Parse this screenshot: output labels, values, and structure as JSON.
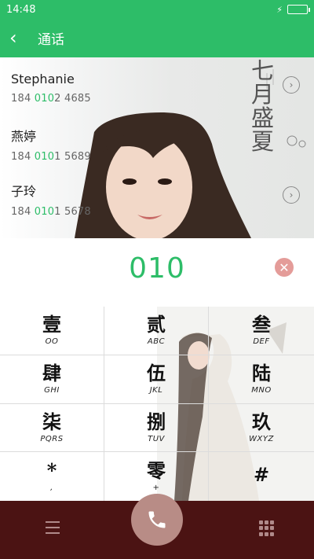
{
  "status": {
    "time": "14:48"
  },
  "header": {
    "title": "通话"
  },
  "results": {
    "art_text": "七月盛夏",
    "contacts": [
      {
        "name": "Stephanie",
        "num_prefix": "184 ",
        "num_match": "010",
        "num_suffix": "2 4685"
      },
      {
        "name": "燕婷",
        "num_prefix": "184 ",
        "num_match": "010",
        "num_suffix": "1 5689"
      },
      {
        "name": "子玲",
        "num_prefix": "184 ",
        "num_match": "010",
        "num_suffix": "1 5678"
      }
    ]
  },
  "dialer": {
    "digits": "010"
  },
  "keypad": {
    "keys": [
      {
        "glyph": "壹",
        "sub": "OO"
      },
      {
        "glyph": "贰",
        "sub": "ABC"
      },
      {
        "glyph": "叁",
        "sub": "DEF"
      },
      {
        "glyph": "肆",
        "sub": "GHI"
      },
      {
        "glyph": "伍",
        "sub": "JKL"
      },
      {
        "glyph": "陆",
        "sub": "MNO"
      },
      {
        "glyph": "柒",
        "sub": "PQRS"
      },
      {
        "glyph": "捌",
        "sub": "TUV"
      },
      {
        "glyph": "玖",
        "sub": "WXYZ"
      },
      {
        "glyph": "*",
        "sub": ","
      },
      {
        "glyph": "零",
        "sub": "+"
      },
      {
        "glyph": "#",
        "sub": ""
      }
    ]
  },
  "colors": {
    "accent": "#2dbd68",
    "bottom_bar": "#4b1313",
    "call_button": "#b88c86",
    "clear_button": "#e49c99"
  },
  "icons": {
    "back": "chevron-left-icon",
    "call": "phone-icon",
    "menu": "menu-icon",
    "dialpad": "dialpad-icon",
    "clear": "clear-icon"
  }
}
